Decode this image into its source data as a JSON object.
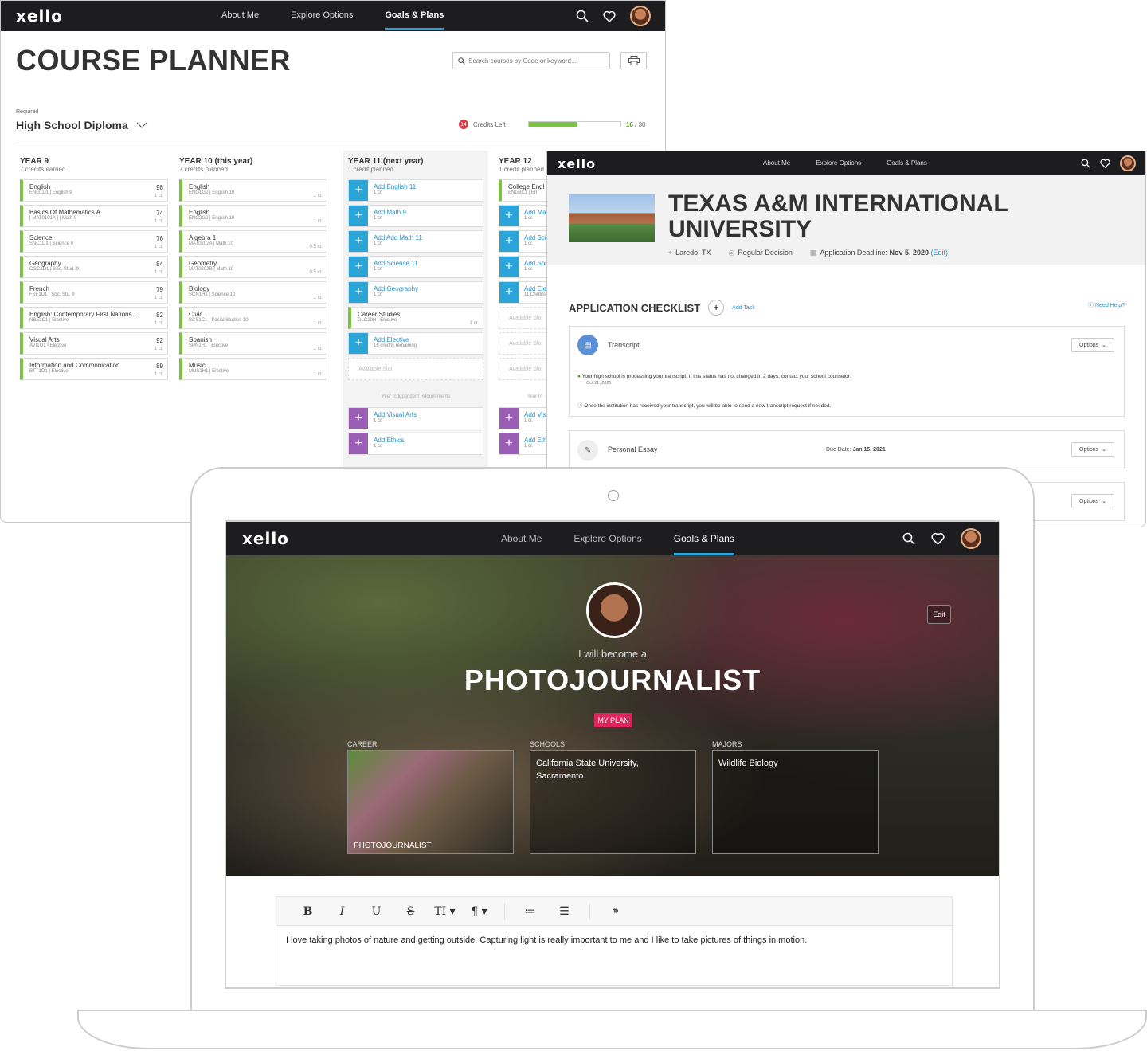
{
  "nav": {
    "logo": "xello",
    "items": [
      "About Me",
      "Explore Options",
      "Goals & Plans"
    ],
    "active": "Goals & Plans"
  },
  "planner": {
    "title": "COURSE PLANNER",
    "search_placeholder": "Search courses by Code or keyword...",
    "required_label": "Required",
    "diploma": "High School Diploma",
    "credits_left_count": "14",
    "credits_left_label": "Credits Left",
    "progress": {
      "earned": "16",
      "total": "/ 30",
      "fraction": 0.53
    },
    "years": [
      {
        "title": "YEAR 9",
        "subtitle": "7 credits earned",
        "courses": [
          {
            "name": "English",
            "code": "ENG1D1",
            "category": "English 9",
            "grade": "98",
            "credit": "1 cr."
          },
          {
            "name": "Basics Of Mathematics A",
            "code": "[ MAT0101A ]",
            "category": "Math 9",
            "grade": "74",
            "credit": "1 cr."
          },
          {
            "name": "Science",
            "code": "SNC1D1",
            "category": "Science 9",
            "grade": "76",
            "credit": "1 cr."
          },
          {
            "name": "Geography",
            "code": "CGC1D1",
            "category": "Soc. Stud. 9",
            "grade": "84",
            "credit": "1 cr."
          },
          {
            "name": "French",
            "code": "FSF1D1",
            "category": "Soc. Stu. 9",
            "grade": "79",
            "credit": "1 cr."
          },
          {
            "name": "English: Contemporary First Nations ...",
            "code": "NBE2C1",
            "category": "Elective",
            "grade": "82",
            "credit": "1 cr."
          },
          {
            "name": "Visual Arts",
            "code": "AVI1O1",
            "category": "Elective",
            "grade": "92",
            "credit": "1 cr."
          },
          {
            "name": "Information and Communication",
            "code": "BTT1O1",
            "category": "Elective",
            "grade": "89",
            "credit": "1 cr."
          }
        ]
      },
      {
        "title": "YEAR 10 (this year)",
        "subtitle": "7 credits planned",
        "courses": [
          {
            "name": "English",
            "code": "ENG1G2",
            "category": "English 10",
            "grade": "",
            "credit": "1 cr."
          },
          {
            "name": "English",
            "code": "ENG2G2",
            "category": "English 10",
            "grade": "",
            "credit": "1 cr."
          },
          {
            "name": "Algebra 1",
            "code": "MAT0202A",
            "category": "Math 10",
            "grade": "",
            "credit": "0.5 cr."
          },
          {
            "name": "Geometry",
            "code": "MAT0202B",
            "category": "Math 10",
            "grade": "",
            "credit": "0.5 cr."
          },
          {
            "name": "Biology",
            "code": "SCN1H1",
            "category": "Science 10",
            "grade": "",
            "credit": "1 cr."
          },
          {
            "name": "Civic",
            "code": "SCS1C1",
            "category": "Social Studies 10",
            "grade": "",
            "credit": "1 cr."
          },
          {
            "name": "Spanish",
            "code": "SPN1H1",
            "category": "Elective",
            "grade": "",
            "credit": "1 cr."
          },
          {
            "name": "Music",
            "code": "MUS1H1",
            "category": "Elective",
            "grade": "",
            "credit": "1 cr."
          }
        ]
      }
    ],
    "year11": {
      "title": "YEAR 11 (next year)",
      "subtitle": "1 credit planned",
      "adds": [
        {
          "name": "Add English 11",
          "sub": "1 cr."
        },
        {
          "name": "Add Math 9",
          "sub": "1 cr."
        },
        {
          "name": "Add Add Math 11",
          "sub": "1 cr."
        },
        {
          "name": "Add Science 11",
          "sub": "1 cr."
        },
        {
          "name": "Add Geography",
          "sub": "1 cr."
        }
      ],
      "course": {
        "name": "Career Studies",
        "code": "GLC20H",
        "category": "Elective",
        "credit": "1 cr."
      },
      "elective": {
        "name": "Add Elective",
        "sub": "16 credits remaining"
      },
      "slot": "Available Slot",
      "indep_label": "Year Independent Requirements",
      "indep": [
        {
          "name": "Add Visual Arts",
          "sub": "1 cr."
        },
        {
          "name": "Add Ethics",
          "sub": "1 cr."
        }
      ]
    },
    "year12": {
      "title": "YEAR 12",
      "subtitle": "1 credit planned",
      "course": {
        "name": "College Engl",
        "code": "ENG3C1",
        "category": "En"
      },
      "adds": [
        {
          "name": "Add Mat",
          "sub": "1 cr."
        },
        {
          "name": "Add Sci",
          "sub": "1 cr."
        },
        {
          "name": "Add Soc",
          "sub": "1 cr."
        },
        {
          "name": "Add Ele",
          "sub": "11 Credits"
        }
      ],
      "slots": [
        "Available Slo",
        "Available Slo",
        "Available Slo"
      ],
      "indep_label": "Year In",
      "indep": [
        {
          "name": "Add Vis",
          "sub": "1 cr."
        },
        {
          "name": "Add Eth",
          "sub": "1 cr."
        }
      ]
    }
  },
  "university": {
    "name": "TEXAS A&M INTERNATIONAL UNIVERSITY",
    "location": "Laredo, TX",
    "decision": "Regular Decision",
    "deadline_label": "Application Deadline:",
    "deadline_value": "Nov 5, 2020",
    "deadline_edit": "(Edit)",
    "checklist_title": "APPLICATION CHECKLIST",
    "add_task": "Add Task",
    "need_help": "Need Help?",
    "items": [
      {
        "title": "Transcript",
        "options": "Options",
        "note1": "Your high school is processing your transcript. If this status has not changed in 2 days, contact your school counselor.",
        "note1_date": "Oct 21, 2020",
        "note2": "Once the institution has received your transcript, you will be able to send a new transcript request if needed."
      },
      {
        "title": "Personal Essay",
        "due_label": "Due Date:",
        "due_value": "Jan 15, 2021",
        "options": "Options"
      },
      {
        "title": "",
        "options": "Options"
      }
    ]
  },
  "profile": {
    "edit": "Edit",
    "become": "I will become a",
    "career": "PHOTOJOURNALIST",
    "myplan": "MY PLAN",
    "tiles": [
      {
        "label": "CAREER",
        "text": "",
        "caption": "PHOTOJOURNALIST"
      },
      {
        "label": "SCHOOLS",
        "text": "California State University, Sacramento",
        "caption": ""
      },
      {
        "label": "MAJORS",
        "text": "Wildlife Biology",
        "caption": ""
      }
    ],
    "editor_text": "I love taking photos of nature and getting outside.  Capturing light is really important to me and I like to take pictures of things in motion."
  },
  "colors": {
    "accent_blue": "#2ba4d8",
    "green": "#7dc242",
    "purple": "#9a5fb4",
    "pink": "#e0245e",
    "nav": "#1d1d1f"
  },
  "icons": [
    "search-icon",
    "heart-icon",
    "print-icon",
    "chevron-down-icon",
    "location-icon",
    "check-circle-icon",
    "calendar-icon",
    "plus-icon",
    "info-icon",
    "document-icon",
    "edit-icon",
    "bold-icon",
    "italic-icon",
    "underline-icon",
    "strikethrough-icon",
    "text-size-icon",
    "paragraph-icon",
    "ordered-list-icon",
    "bullet-list-icon",
    "link-icon"
  ]
}
